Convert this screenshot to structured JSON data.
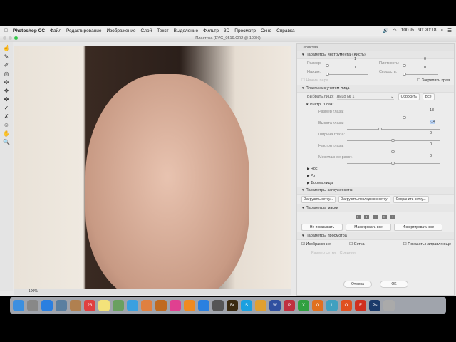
{
  "menubar": {
    "app": "Photoshop CC",
    "items": [
      "Файл",
      "Редактирование",
      "Изображение",
      "Слой",
      "Текст",
      "Выделение",
      "Фильтр",
      "3D",
      "Просмотр",
      "Окно",
      "Справка"
    ],
    "battery": "100 %",
    "clock": "Чт 20:18"
  },
  "window": {
    "title": "Пластика (EVG_0519.CR2 @ 100%)",
    "zoom": "100%"
  },
  "panel": {
    "title": "Свойства",
    "brush": {
      "header": "Параметры инструмента «Кисть»",
      "size_label": "Размер:",
      "size": "1",
      "density_label": "Плотность:",
      "density": "0",
      "pressure_label": "Нажим:",
      "pressure": "1",
      "rate_label": "Скорость:",
      "rate": "0",
      "stylus": "Нажим пера",
      "pin_edges": "Закрепить края"
    },
    "face": {
      "header": "Пластика с учетом лица",
      "select_label": "Выбрать лицо:",
      "select_value": "Лицо № 1",
      "reset": "Сбросить",
      "all": "Все",
      "eyes_header": "Инстр. \"Глаз\"",
      "eyes": [
        {
          "label": "Размер глаза:",
          "value": "13",
          "pos": 0.62
        },
        {
          "label": "Высота глаза:",
          "value": "-14",
          "pos": 0.36
        },
        {
          "label": "Ширина глаза:",
          "value": "0",
          "pos": 0.5
        },
        {
          "label": "Наклон глаза:",
          "value": "0",
          "pos": 0.5
        },
        {
          "label": "Межглазное расст.:",
          "value": "0",
          "pos": 0.5
        }
      ],
      "nose": "Нос",
      "mouth": "Рот",
      "face_shape": "Форма лица"
    },
    "mesh": {
      "header": "Параметры загрузки сетки",
      "load": "Загрузить сетку...",
      "load_last": "Загрузить последнюю сетку",
      "save": "Сохранить сетку..."
    },
    "mask": {
      "header": "Параметры маски",
      "none": "Не показывать",
      "mask_all": "Маскировать все",
      "invert_all": "Инвертировать все"
    },
    "view": {
      "header": "Параметры просмотра",
      "image": "Изображение",
      "grid": "Сетка",
      "guides": "Показать направляюще",
      "grid_size_label": "Размер сетки:",
      "grid_size": "Средняя"
    },
    "cancel": "Отмена",
    "ok": "OK"
  },
  "dock": [
    "Finder",
    "Launchpad",
    "Safari",
    "Preview",
    "Contacts",
    "23",
    "Notes",
    "Photo",
    "Messages",
    "Photos",
    "iBooks",
    "iTunes",
    "Books",
    "App Store",
    "Settings",
    "Br",
    "S",
    "Chrome",
    "W",
    "P",
    "X",
    "O",
    "L",
    "O",
    "F",
    "Ps",
    "Trash"
  ]
}
